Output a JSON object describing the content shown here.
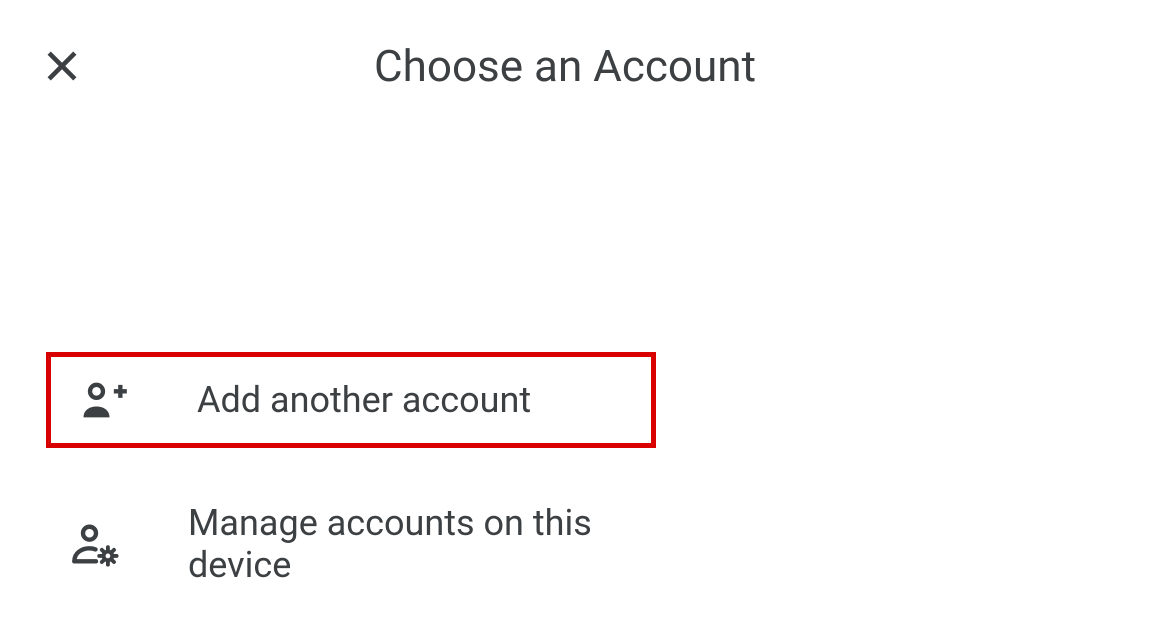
{
  "header": {
    "title": "Choose an Account"
  },
  "options": {
    "add_account": {
      "label": "Add another account",
      "highlighted": true
    },
    "manage_accounts": {
      "label": "Manage accounts on this device",
      "highlighted": false
    }
  }
}
